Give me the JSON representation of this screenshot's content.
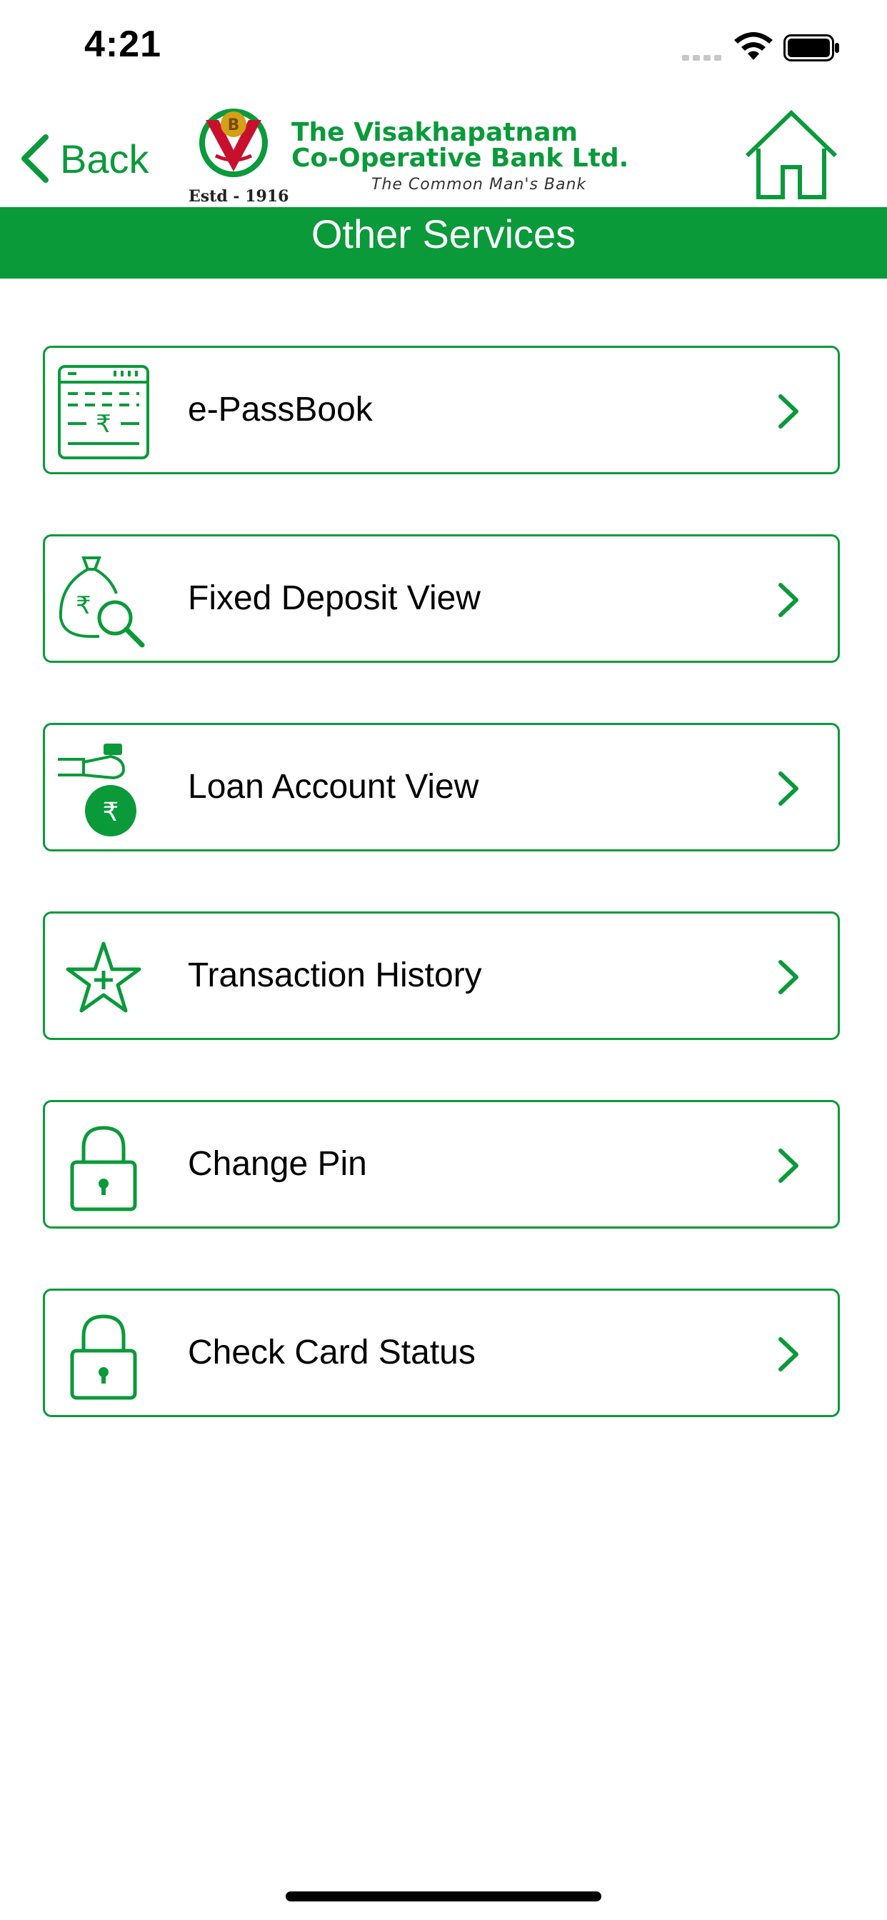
{
  "status_bar": {
    "time": "4:21"
  },
  "header": {
    "back_label": "Back",
    "logo": {
      "name_line1": "The Visakhapatnam",
      "name_line2": "Co-Operative Bank Ltd.",
      "tagline": "The Common Man's Bank",
      "established": "Estd - 1916"
    }
  },
  "page": {
    "title": "Other Services"
  },
  "menu": {
    "items": [
      {
        "label": "e-PassBook",
        "icon": "passbook-icon"
      },
      {
        "label": "Fixed Deposit View",
        "icon": "fixed-deposit-search-icon"
      },
      {
        "label": "Loan Account View",
        "icon": "loan-money-bag-icon"
      },
      {
        "label": "Transaction History",
        "icon": "star-plus-icon"
      },
      {
        "label": "Change Pin",
        "icon": "lock-icon"
      },
      {
        "label": "Check Card Status",
        "icon": "lock-icon"
      }
    ]
  },
  "colors": {
    "brand_green": "#0a9a3a",
    "text": "#000000",
    "background": "#ffffff"
  }
}
